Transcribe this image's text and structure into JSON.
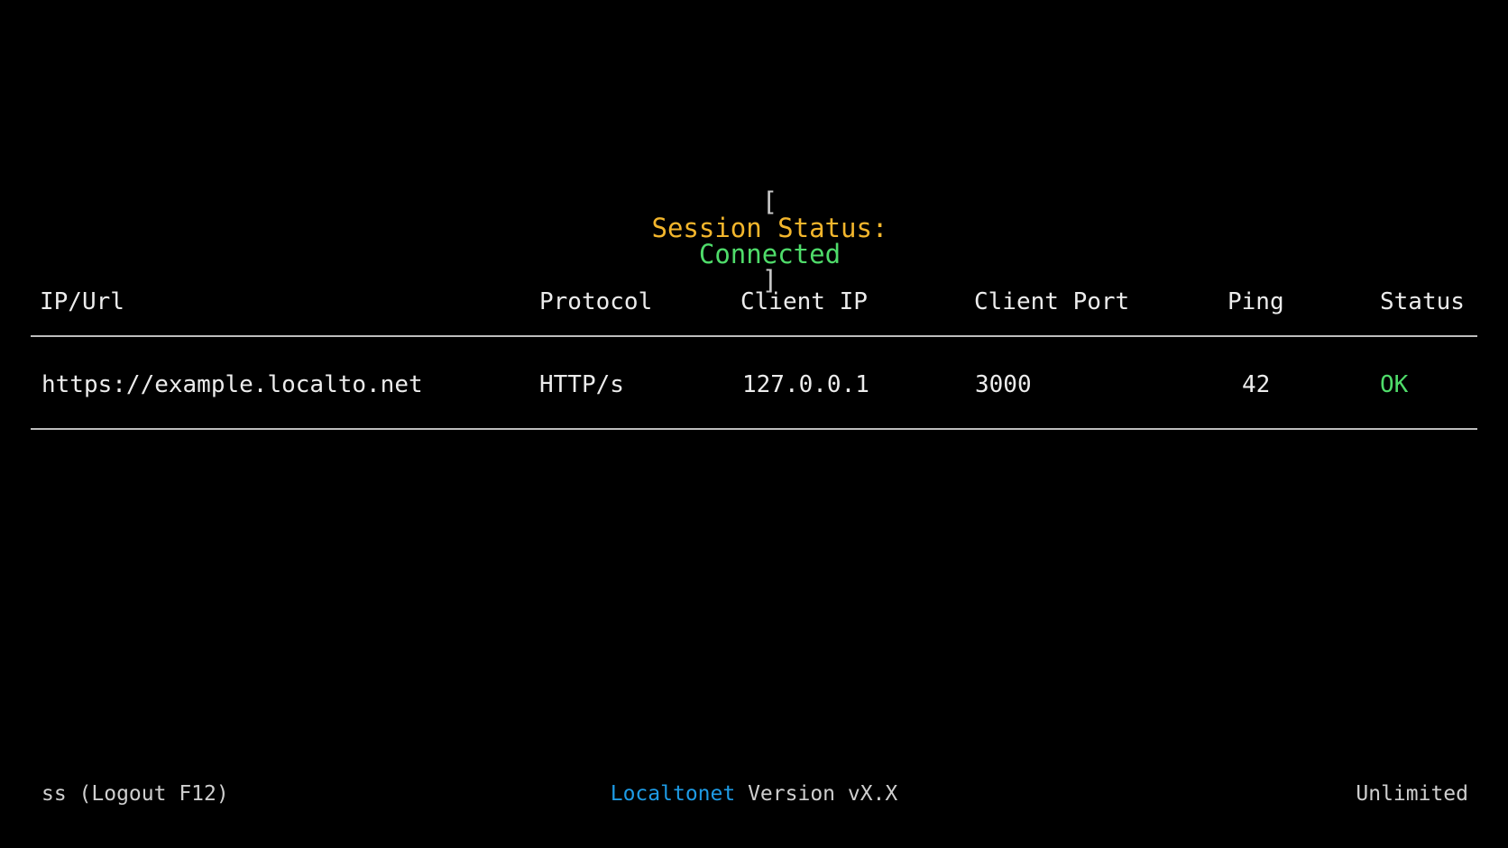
{
  "session": {
    "open_bracket": "[",
    "label": "Session Status:",
    "state": "Connected",
    "close_bracket": "]"
  },
  "table": {
    "headers": [
      "IP/Url",
      "Protocol",
      "Client IP",
      "Client Port",
      "Ping",
      "Status"
    ],
    "rows": [
      {
        "ip_url": "https://example.localto.net",
        "protocol": "HTTP/s",
        "client_ip": "127.0.0.1",
        "client_port": "3000",
        "ping": "42",
        "status": "OK"
      }
    ]
  },
  "footer": {
    "left": "ss (Logout F12)",
    "brand": "Localtonet",
    "version": "Version vX.X",
    "right": "Unlimited"
  },
  "colors": {
    "background": "#000000",
    "session_label": "#f3b62c",
    "connected": "#4fdc6a",
    "brand": "#1e9be5",
    "text": "#ececec"
  }
}
